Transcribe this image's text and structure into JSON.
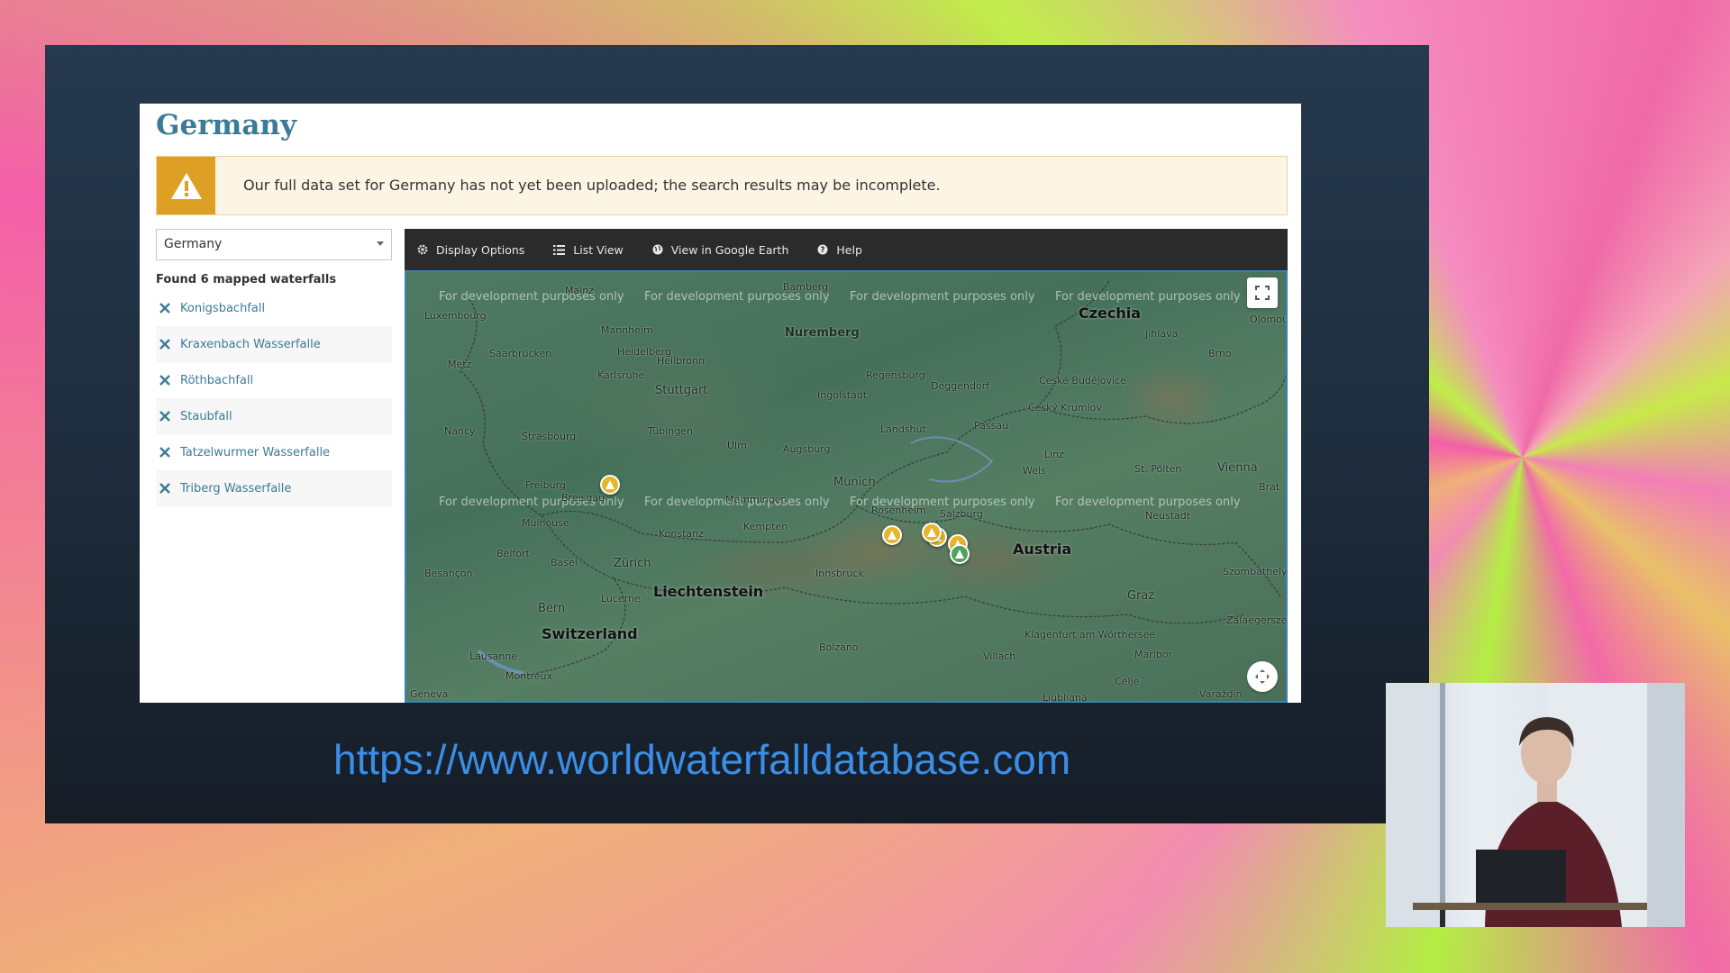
{
  "page": {
    "title": "Germany",
    "alert": "Our full data set for Germany has not yet been uploaded; the search results may be incomplete.",
    "alert_icon": "warning-icon",
    "country_select": "Germany",
    "result_count": "Found 6 mapped waterfalls",
    "results": [
      "Konigsbachfall",
      "Kraxenbach Wasserfalle",
      "Röthbachfall",
      "Staubfall",
      "Tatzelwurmer Wasserfalle",
      "Triberg Wasserfalle"
    ]
  },
  "toolbar": {
    "display_options": "Display Options",
    "list_view": "List View",
    "google_earth": "View in Google Earth",
    "help": "Help"
  },
  "map": {
    "dev_notice": "For development purposes only",
    "regions": {
      "czechia": "Czechia",
      "austria": "Austria",
      "liechtenstein": "Liechtenstein",
      "switzerland": "Switzerland"
    },
    "cities": {
      "mainz": "Mainz",
      "bamberg": "Bamberg",
      "luxembourg": "Luxembourg",
      "mannheim": "Mannheim",
      "nuremberg": "Nuremberg",
      "saarbrucken": "Saarbrücken",
      "heidelberg": "Heidelberg",
      "metz": "Metz",
      "heilbronn": "Heilbronn",
      "karlsruhe": "Karlsruhe",
      "regensburg": "Regensburg",
      "deggendorf": "Deggendorf",
      "budejovice": "České Budějovice",
      "krumlov": "Český Krumlov",
      "brno": "Brno",
      "jihlava": "Jihlava",
      "stuttgart": "Stuttgart",
      "ingolstadt": "Ingolstadt",
      "nancy": "Nancy",
      "strasbourg": "Strasbourg",
      "tubingen": "Tübingen",
      "landshut": "Landshut",
      "passau": "Passau",
      "ulm": "Ulm",
      "augsburg": "Augsburg",
      "linz": "Linz",
      "munich": "Munich",
      "wels": "Wels",
      "stpolten": "St. Pölten",
      "vienna": "Vienna",
      "freiburg": "Freiburg",
      "breisgau": "Breisgau",
      "memmingen": "Memmingen",
      "rosenheim": "Rosenheim",
      "mulhouse": "Mulhouse",
      "konstanz": "Konstanz",
      "kempten": "Kempten",
      "salzburg": "Salzburg",
      "neustadt": "Neustadt",
      "belfort": "Belfort",
      "basel": "Basel",
      "zurich": "Zürich",
      "innsbruck": "Innsbruck",
      "szombathely": "Szombathely",
      "besancon": "Besançon",
      "bern": "Bern",
      "lucerne": "Lucerne",
      "graz": "Graz",
      "zalaegerszeg": "Zalaegerszeg",
      "bolzano": "Bolzano",
      "klagenfurt": "Klagenfurt am Wörthersee",
      "lausanne": "Lausanne",
      "villach": "Villach",
      "maribor": "Maribor",
      "montreux": "Montreux",
      "geneva": "Geneva",
      "bratislava": "Brat",
      "olomouc": "Olomou",
      "varazdin": "Varaždin",
      "celje": "Celje",
      "ljubljana": "Ljubljana"
    }
  },
  "footer": {
    "url": "https://www.worldwaterfalldatabase.com"
  },
  "colors": {
    "title": "#3b7a98",
    "alert_bg": "#fcf5e4",
    "alert_icon_bg": "#dea024",
    "link": "#3b7a98",
    "toolbar_bg": "#2b2b2b",
    "url": "#3b8ee6",
    "marker_gold": "#e5b62c",
    "marker_green": "#4fa25a"
  }
}
